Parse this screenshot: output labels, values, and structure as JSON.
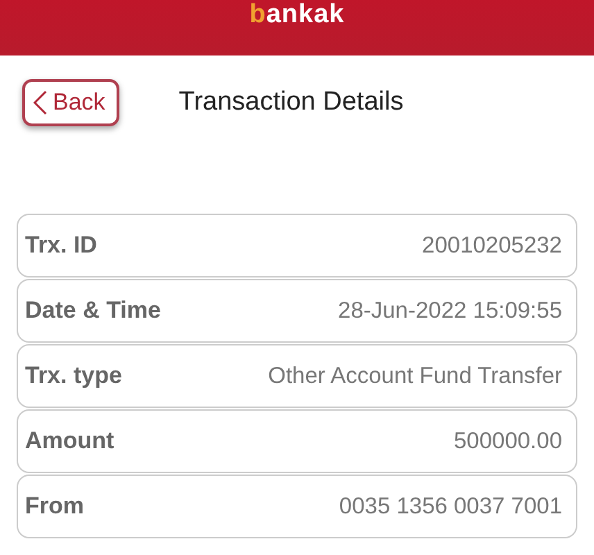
{
  "header": {
    "logo": "bankak"
  },
  "back_button": {
    "label": "Back"
  },
  "title": "Transaction Details",
  "details": [
    {
      "label": "Trx. ID",
      "value": "20010205232"
    },
    {
      "label": "Date & Time",
      "value": "28-Jun-2022 15:09:55"
    },
    {
      "label": "Trx. type",
      "value": "Other Account Fund Transfer"
    },
    {
      "label": "Amount",
      "value": "500000.00"
    },
    {
      "label": "From",
      "value": "0035 1356 0037 7001"
    }
  ]
}
